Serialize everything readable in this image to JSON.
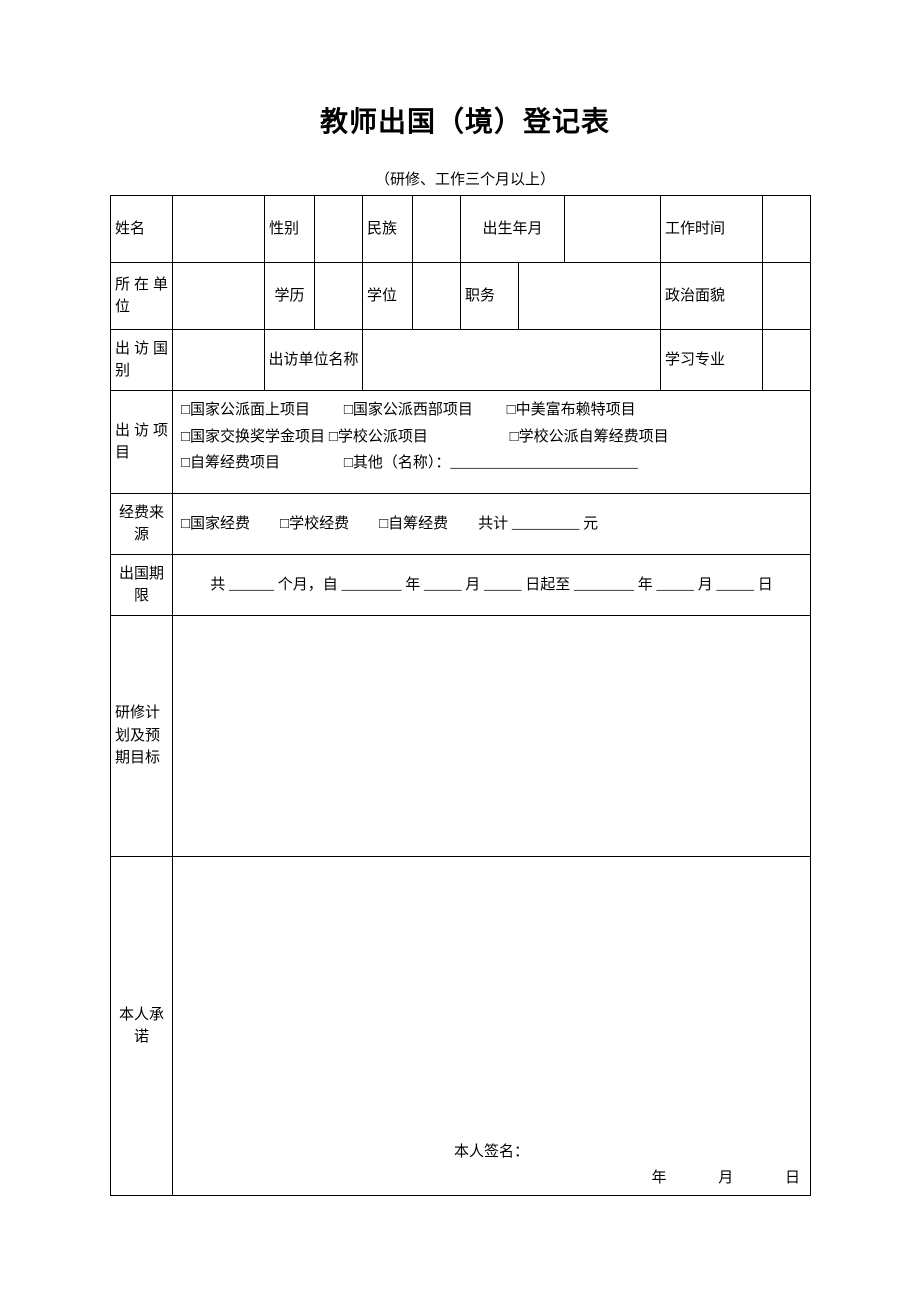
{
  "title": "教师出国（境）登记表",
  "subtitle": "（研修、工作三个月以上）",
  "labels": {
    "name": "姓名",
    "gender": "性别",
    "ethnicity": "民族",
    "birth": "出生年月",
    "work_time": "工作时间",
    "unit": "所在单位",
    "education": "学历",
    "degree": "学位",
    "position": "职务",
    "political": "政治面貌",
    "country": "出访国别",
    "visit_unit": "出访单位名称",
    "major": "学习专业",
    "project": "出访项目",
    "fund_source": "经费来源",
    "duration": "出国期限",
    "plan": "研修计划及预期目标",
    "commitment": "本人承诺"
  },
  "project_options": {
    "a": "□国家公派面上项目",
    "b": "□国家公派西部项目",
    "c": "□中美富布赖特项目",
    "d": "□国家交换奖学金项目",
    "e": "□学校公派项目",
    "f": "□学校公派自筹经费项目",
    "g": "□自筹经费项目",
    "h": "□其他（名称）：_________________________"
  },
  "fund_line": "□国家经费  □学校经费  □自筹经费  共计 _________ 元",
  "duration_line": "共 ______ 个月，自 ________ 年 _____ 月 _____ 日起至 ________ 年 _____ 月 _____ 日",
  "signature_label": "本人签名：",
  "date_parts": {
    "y": "年",
    "m": "月",
    "d": "日"
  }
}
